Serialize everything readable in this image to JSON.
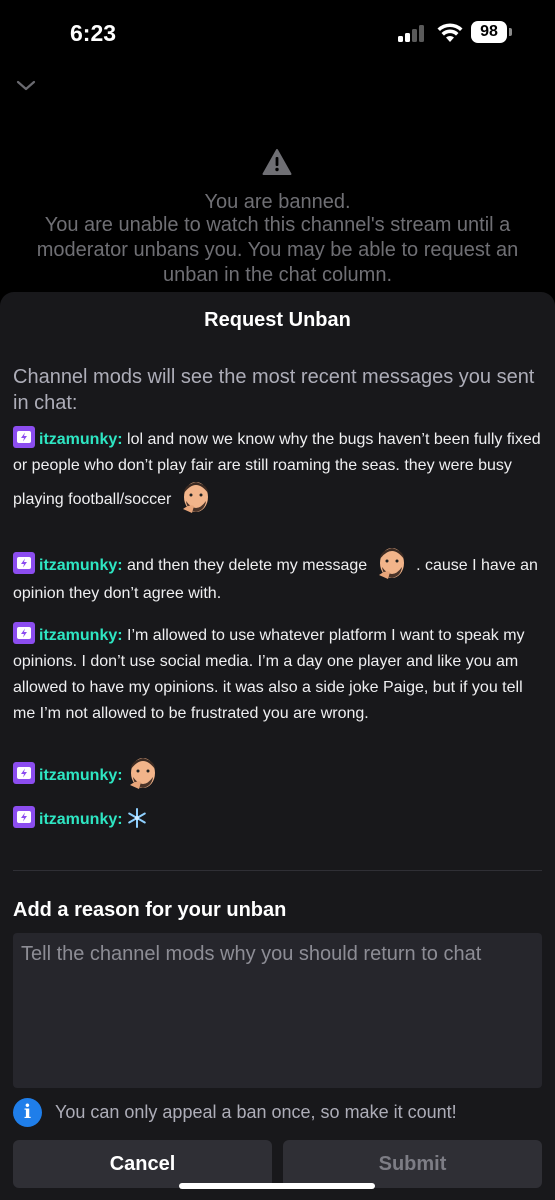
{
  "status_bar": {
    "time": "6:23",
    "battery": "98"
  },
  "banned": {
    "title": "You are banned.",
    "message": "You are unable to watch this channel's stream until a moderator unbans you. You may be able to request an unban in the chat column."
  },
  "sheet": {
    "title": "Request Unban",
    "mods_note": "Channel mods will see the most recent messages you sent in chat:",
    "messages": [
      {
        "user": "itzamunky:",
        "text_before": " lol and now we know why the bugs haven’t been fully fixed or people who don’t play fair are still roaming the seas. they were busy playing football/soccer ",
        "text_after": ""
      },
      {
        "user": "itzamunky:",
        "text_before": " and then they delete my message ",
        "text_after": " . cause I have an opinion they don’t agree with."
      },
      {
        "user": "itzamunky:",
        "text_before": " I’m allowed to use whatever platform I want to speak my opinions. I don’t use social media. I’m a day one player and like you am allowed to have my opinions. it was also a side joke Paige, but if you tell me I’m not allowed to be frustrated you are wrong.",
        "text_after": ""
      },
      {
        "user": "itzamunky:",
        "text_before": " ",
        "text_after": ""
      },
      {
        "user": "itzamunky:",
        "text_before": " ",
        "text_after": ""
      }
    ],
    "reason_label": "Add a reason for your unban",
    "reason_placeholder": "Tell the channel mods why you should return to chat",
    "reason_value": "",
    "info_text": "You can only appeal a ban once, so make it count!",
    "cancel_label": "Cancel",
    "submit_label": "Submit"
  },
  "colors": {
    "username": "#2ee6c3",
    "badge": "#8c4df0",
    "info": "#1f7eea",
    "sheet_bg": "#18181b"
  },
  "icons": [
    "chevron-down-icon",
    "warning-icon",
    "turbo-badge-icon",
    "face-emote-icon",
    "snowflake-emote-icon",
    "info-icon"
  ]
}
